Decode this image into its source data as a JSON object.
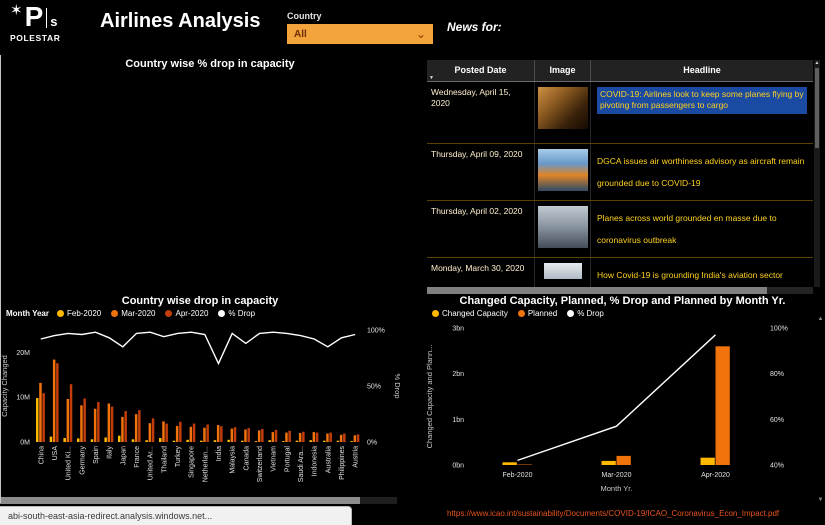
{
  "colors": {
    "accent": "#F2A33C",
    "headline_text": "#FFD21E",
    "row_highlight": "#1B4AA2",
    "link": "#E8541F"
  },
  "icons": {
    "logo_star": "✶",
    "sort": "▼",
    "dropdown_chevron": "⌄",
    "scroll_up": "▲",
    "scroll_down": "▼"
  },
  "header": {
    "logo": {
      "star": "✶",
      "letter_p": "P",
      "letter_s": "s",
      "brand": "POLESTAR"
    },
    "title": "Airlines Analysis",
    "filter": {
      "label": "Country",
      "value": "All"
    },
    "news_label": "News for:"
  },
  "map_panel": {
    "title": "Country wise % drop in capacity"
  },
  "news_table": {
    "columns": [
      "Posted Date",
      "Image",
      "Headline"
    ],
    "rows": [
      {
        "date": "Wednesday, April 15, 2020",
        "headline": "COVID-19: Airlines look to keep some planes flying by pivoting from passengers to cargo"
      },
      {
        "date": "Thursday, April 09, 2020",
        "headline": "DGCA issues air worthiness advisory as aircraft remain grounded due to COVID-19"
      },
      {
        "date": "Thursday, April 02, 2020",
        "headline": "Planes across world grounded en masse due to coronavirus outbreak"
      },
      {
        "date": "Monday, March 30, 2020",
        "headline": "How Covid-19 is grounding India's aviation sector"
      }
    ]
  },
  "chart_data": [
    {
      "id": "country-capacity",
      "type": "bar",
      "title": "Country wise drop in capacity",
      "legend_title": "Month Year",
      "legend_position": "top-left",
      "grid": false,
      "value_unit": "M",
      "categories": [
        "China",
        "USA",
        "United Ki...",
        "Germany",
        "Spain",
        "Italy",
        "Japan",
        "France",
        "United Ar...",
        "Thailand",
        "Turkey",
        "Singapore",
        "Netherlan...",
        "India",
        "Malaysia",
        "Canada",
        "Switzerland",
        "Vietnam",
        "Portugal",
        "Saudi Ara...",
        "Indonesia",
        "Australia",
        "Philippines",
        "Austria"
      ],
      "series": [
        {
          "name": "Feb-2020",
          "color": "#FFB900",
          "values": [
            9.8,
            1.2,
            0.9,
            0.8,
            0.6,
            1.0,
            1.4,
            0.6,
            0.4,
            0.9,
            0.3,
            0.5,
            0.3,
            0.4,
            0.5,
            0.3,
            0.2,
            0.4,
            0.2,
            0.3,
            0.4,
            0.3,
            0.3,
            0.2
          ]
        },
        {
          "name": "Mar-2020",
          "color": "#F0730C",
          "values": [
            13.2,
            18.4,
            9.6,
            8.2,
            7.4,
            8.6,
            5.6,
            6.2,
            4.2,
            4.6,
            3.6,
            3.4,
            3.2,
            3.8,
            3.0,
            2.8,
            2.6,
            2.2,
            2.1,
            2.0,
            2.2,
            1.9,
            1.6,
            1.5
          ]
        },
        {
          "name": "Apr-2020",
          "color": "#C23D0A",
          "values": [
            10.9,
            17.6,
            12.9,
            9.7,
            8.9,
            7.9,
            6.9,
            7.1,
            5.3,
            4.1,
            4.5,
            4.1,
            3.9,
            3.5,
            3.3,
            3.1,
            2.9,
            2.7,
            2.5,
            2.3,
            2.1,
            2.1,
            1.9,
            1.7
          ]
        }
      ],
      "line_series": {
        "name": "% Drop",
        "color": "#FFFFFF",
        "values": [
          92,
          95,
          97,
          96,
          98,
          93,
          85,
          97,
          98,
          94,
          97,
          98,
          96,
          70,
          97,
          88,
          97,
          98,
          97,
          95,
          92,
          85,
          93,
          96
        ]
      },
      "ylabel": "Capacity Changed",
      "y2label": "% Drop",
      "yticks": [
        "0M",
        "10M",
        "20M"
      ],
      "ytick_values": [
        0,
        10,
        20
      ],
      "ylim": [
        0,
        25
      ],
      "y2ticks": [
        "0%",
        "50%",
        "100%"
      ],
      "y2tick_values": [
        0,
        50,
        100
      ],
      "y2lim": [
        0,
        100
      ]
    },
    {
      "id": "month-capacity",
      "type": "bar",
      "title": "Changed Capacity, Planned, % Drop and Planned by Month Yr.",
      "legend_position": "top-left",
      "grid": false,
      "value_unit": "bn",
      "categories": [
        "Feb-2020",
        "Mar-2020",
        "Apr-2020"
      ],
      "series": [
        {
          "name": "Changed Capacity",
          "color": "#FFB900",
          "values": [
            0.06,
            0.09,
            0.16
          ]
        },
        {
          "name": "Planned",
          "color": "#F0730C",
          "values": [
            0.01,
            0.2,
            2.6
          ]
        }
      ],
      "line_series": {
        "name": "% Drop",
        "color": "#FFFFFF",
        "values": [
          42,
          57,
          97
        ]
      },
      "xlabel": "Month Yr.",
      "ylabel": "Changed Capacity and Plann...",
      "yticks": [
        "0bn",
        "1bn",
        "2bn",
        "3bn"
      ],
      "ytick_values": [
        0,
        1,
        2,
        3
      ],
      "ylim": [
        0,
        3
      ],
      "y2ticks": [
        "40%",
        "60%",
        "80%",
        "100%"
      ],
      "y2tick_values": [
        40,
        60,
        80,
        100
      ],
      "y2lim": [
        40,
        100
      ]
    }
  ],
  "footer": {
    "status_url": "abi-south-east-asia-redirect.analysis.windows.net...",
    "source_link": "https://www.icao.int/sustainability/Documents/COVID-19/ICAO_Coronavirus_Econ_Impact.pdf"
  }
}
